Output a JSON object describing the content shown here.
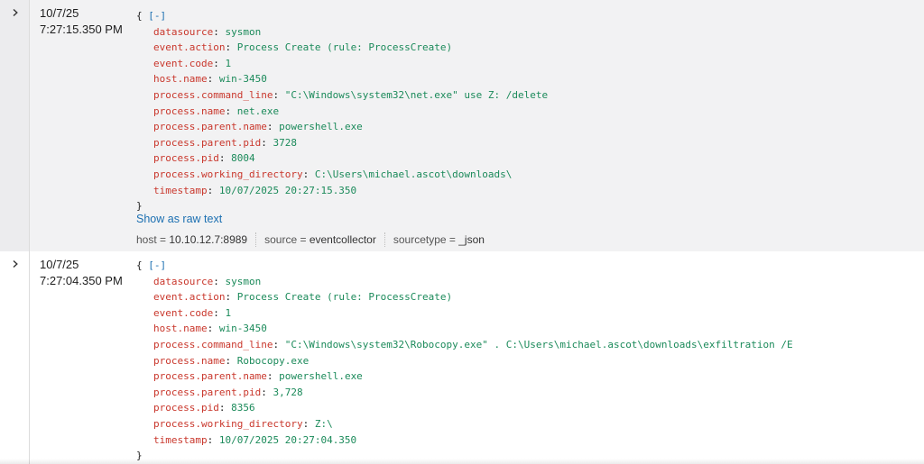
{
  "events": [
    {
      "date": "10/7/25",
      "time": "7:27:15.350 PM",
      "open_brace": "{",
      "collapse_toggle": "[-]",
      "close_brace": "}",
      "fields": [
        {
          "key": "datasource",
          "sep": ": ",
          "value": "sysmon"
        },
        {
          "key": "event.action",
          "sep": ": ",
          "value": "Process Create (rule: ProcessCreate)"
        },
        {
          "key": "event.code",
          "sep": ": ",
          "value": "1"
        },
        {
          "key": "host.name",
          "sep": ": ",
          "value": "win-3450"
        },
        {
          "key": "process.command_line",
          "sep": ": ",
          "value": "\"C:\\Windows\\system32\\net.exe\" use Z: /delete"
        },
        {
          "key": "process.name",
          "sep": ": ",
          "value": "net.exe"
        },
        {
          "key": "process.parent.name",
          "sep": ": ",
          "value": "powershell.exe"
        },
        {
          "key": "process.parent.pid",
          "sep": ": ",
          "value": "3728"
        },
        {
          "key": "process.pid",
          "sep": ": ",
          "value": "8004"
        },
        {
          "key": "process.working_directory",
          "sep": ": ",
          "value": "C:\\Users\\michael.ascot\\downloads\\"
        },
        {
          "key": "timestamp",
          "sep": ": ",
          "value": "10/07/2025 20:27:15.350"
        }
      ],
      "show_raw_label": "Show as raw text",
      "meta": [
        {
          "key": "host = ",
          "value": "10.10.12.7:8989"
        },
        {
          "key": "source = ",
          "value": "eventcollector"
        },
        {
          "key": "sourcetype = ",
          "value": "_json"
        }
      ]
    },
    {
      "date": "10/7/25",
      "time": "7:27:04.350 PM",
      "open_brace": "{",
      "collapse_toggle": "[-]",
      "close_brace": "}",
      "fields": [
        {
          "key": "datasource",
          "sep": ": ",
          "value": "sysmon"
        },
        {
          "key": "event.action",
          "sep": ": ",
          "value": "Process Create (rule: ProcessCreate)"
        },
        {
          "key": "event.code",
          "sep": ": ",
          "value": "1"
        },
        {
          "key": "host.name",
          "sep": ": ",
          "value": "win-3450"
        },
        {
          "key": "process.command_line",
          "sep": ": ",
          "value": "\"C:\\Windows\\system32\\Robocopy.exe\" . C:\\Users\\michael.ascot\\downloads\\exfiltration /E"
        },
        {
          "key": "process.name",
          "sep": ": ",
          "value": "Robocopy.exe"
        },
        {
          "key": "process.parent.name",
          "sep": ": ",
          "value": "powershell.exe"
        },
        {
          "key": "process.parent.pid",
          "sep": ": ",
          "value": "3,728"
        },
        {
          "key": "process.pid",
          "sep": ": ",
          "value": "8356"
        },
        {
          "key": "process.working_directory",
          "sep": ": ",
          "value": "Z:\\"
        },
        {
          "key": "timestamp",
          "sep": ": ",
          "value": "10/07/2025 20:27:04.350"
        }
      ]
    }
  ],
  "icons": {
    "expand": "chevron-right-icon"
  },
  "colors": {
    "key": "#c9372c",
    "value": "#1b8a5a",
    "link": "#1b6fb1",
    "selected_row_bg": "#f2f2f3"
  }
}
